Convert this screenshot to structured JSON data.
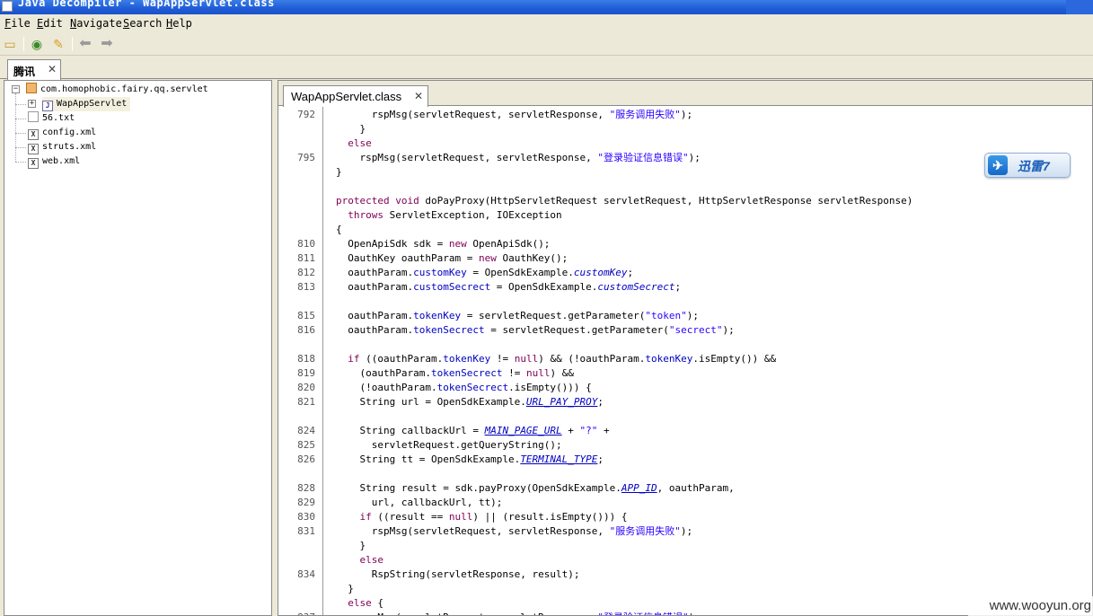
{
  "window": {
    "title": "Java Decompiler - WapAppServlet.class"
  },
  "menu": [
    "File",
    "Edit",
    "Navigate",
    "Search",
    "Help"
  ],
  "outer_tab": {
    "label": "腾讯",
    "close": "✕"
  },
  "tree": {
    "package": "com.homophobic.fairy.qq.servlet",
    "class": "WapAppServlet",
    "files": [
      "56.txt",
      "config.xml",
      "struts.xml",
      "web.xml"
    ]
  },
  "editor_tab": {
    "label": "WapAppServlet.class",
    "close": "✕"
  },
  "icons": {
    "open": "folder-open-icon",
    "open_type": "open-type-icon",
    "search": "search-icon",
    "back": "back-arrow-icon",
    "forward": "forward-arrow-icon"
  },
  "code": [
    {
      "n": "792",
      "html": "      rspMsg(servletRequest, servletResponse, <span class=\"str\">\"服务调用失败\"</span>);"
    },
    {
      "n": "",
      "html": "    }"
    },
    {
      "n": "",
      "html": "  <span class=\"kw\">else</span>"
    },
    {
      "n": "795",
      "html": "    rspMsg(servletRequest, servletResponse, <span class=\"str\">\"登录验证信息错误\"</span>);"
    },
    {
      "n": "",
      "html": "}"
    },
    {
      "n": "",
      "html": ""
    },
    {
      "n": "",
      "html": "<span class=\"kw\">protected void</span> doPayProxy(HttpServletRequest servletRequest, HttpServletResponse servletResponse)"
    },
    {
      "n": "",
      "html": "  <span class=\"kw\">throws</span> ServletException, IOException"
    },
    {
      "n": "",
      "html": "{"
    },
    {
      "n": "810",
      "html": "  OpenApiSdk sdk = <span class=\"kw\">new</span> OpenApiSdk();"
    },
    {
      "n": "811",
      "html": "  OauthKey oauthParam = <span class=\"kw\">new</span> OauthKey();"
    },
    {
      "n": "812",
      "html": "  oauthParam.<span class=\"fld\">customKey</span> = OpenSdkExample.<span class=\"ital\">customKey</span>;"
    },
    {
      "n": "813",
      "html": "  oauthParam.<span class=\"fld\">customSecrect</span> = OpenSdkExample.<span class=\"ital\">customSecrect</span>;"
    },
    {
      "n": "",
      "html": ""
    },
    {
      "n": "815",
      "html": "  oauthParam.<span class=\"fld\">tokenKey</span> = servletRequest.getParameter(<span class=\"str\">\"token\"</span>);"
    },
    {
      "n": "816",
      "html": "  oauthParam.<span class=\"fld\">tokenSecrect</span> = servletRequest.getParameter(<span class=\"str\">\"secrect\"</span>);"
    },
    {
      "n": "",
      "html": ""
    },
    {
      "n": "818",
      "html": "  <span class=\"kw\">if</span> ((oauthParam.<span class=\"fld\">tokenKey</span> != <span class=\"kw\">null</span>) &amp;&amp; (!oauthParam.<span class=\"fld\">tokenKey</span>.isEmpty()) &amp;&amp;"
    },
    {
      "n": "819",
      "html": "    (oauthParam.<span class=\"fld\">tokenSecrect</span> != <span class=\"kw\">null</span>) &amp;&amp;"
    },
    {
      "n": "820",
      "html": "    (!oauthParam.<span class=\"fld\">tokenSecrect</span>.isEmpty())) {"
    },
    {
      "n": "821",
      "html": "    String url = OpenSdkExample.<span class=\"ital\"><u>URL_PAY_PROY</u></span>;"
    },
    {
      "n": "",
      "html": ""
    },
    {
      "n": "824",
      "html": "    String callbackUrl = <span class=\"ital\"><u>MAIN_PAGE_URL</u></span> + <span class=\"str\">\"?\"</span> +"
    },
    {
      "n": "825",
      "html": "      servletRequest.getQueryString();"
    },
    {
      "n": "826",
      "html": "    String tt = OpenSdkExample.<span class=\"ital\"><u>TERMINAL_TYPE</u></span>;"
    },
    {
      "n": "",
      "html": ""
    },
    {
      "n": "828",
      "html": "    String result = sdk.payProxy(OpenSdkExample.<span class=\"ital\"><u>APP_ID</u></span>, oauthParam,"
    },
    {
      "n": "829",
      "html": "      url, callbackUrl, tt);"
    },
    {
      "n": "830",
      "html": "    <span class=\"kw\">if</span> ((result == <span class=\"kw\">null</span>) || (result.isEmpty())) {"
    },
    {
      "n": "831",
      "html": "      rspMsg(servletRequest, servletResponse, <span class=\"str\">\"服务调用失败\"</span>);"
    },
    {
      "n": "",
      "html": "    }"
    },
    {
      "n": "",
      "html": "    <span class=\"kw\">else</span>"
    },
    {
      "n": "834",
      "html": "      RspString(servletResponse, result);"
    },
    {
      "n": "",
      "html": "  }"
    },
    {
      "n": "",
      "html": "  <span class=\"kw\">else</span> {"
    },
    {
      "n": "837",
      "html": "    rspMsg(servletRequest, servletResponse, <span class=\"str\">\"登录验证信息错误\"</span>);"
    }
  ],
  "overlay": {
    "xunlei_label": "迅雷7"
  },
  "watermark": "www.wooyun.org"
}
